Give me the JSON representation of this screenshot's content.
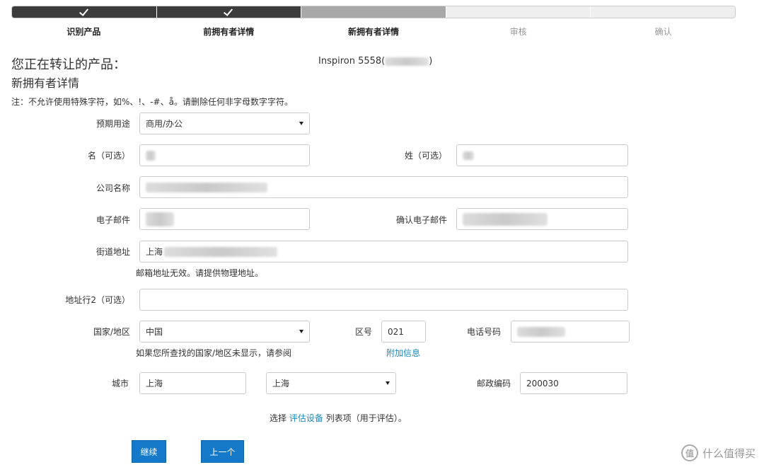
{
  "progress": {
    "steps": [
      {
        "label": "识别产品",
        "state": "done"
      },
      {
        "label": "前拥有者详情",
        "state": "done"
      },
      {
        "label": "新拥有者详情",
        "state": "current"
      },
      {
        "label": "审核",
        "state": "todo"
      },
      {
        "label": "确认",
        "state": "todo"
      }
    ]
  },
  "header": {
    "title": "您正在转让的产品：",
    "product": "Inspiron 5558(",
    "product_close": ")",
    "subtitle": "新拥有者详情",
    "note": "注：不允许使用特殊字符，如%、!、-#、å。请删除任何非字母数字字符。"
  },
  "form": {
    "usage": {
      "label": "预期用途",
      "value": "商用/办公"
    },
    "first_name": {
      "label": "名（可选）",
      "value": ""
    },
    "last_name": {
      "label": "姓（可选）",
      "value": ""
    },
    "company": {
      "label": "公司名称",
      "value": ""
    },
    "email": {
      "label": "电子邮件",
      "value": ""
    },
    "confirm_email": {
      "label": "确认电子邮件",
      "value": ""
    },
    "street": {
      "label": "街道地址",
      "value": "上海",
      "help": "邮箱地址无效。请提供物理地址。"
    },
    "address2": {
      "label": "地址行2（可选）",
      "value": ""
    },
    "country": {
      "label": "国家/地区",
      "value": "中国",
      "help": "如果您所查找的国家/地区未显示，请参阅"
    },
    "area_code": {
      "label": "区号",
      "value": "021",
      "help_link": "附加信息"
    },
    "phone": {
      "label": "电话号码",
      "value": ""
    },
    "city": {
      "label": "城市",
      "value": "上海"
    },
    "province": {
      "value": "上海"
    },
    "postal": {
      "label": "邮政编码",
      "value": "200030"
    },
    "eval_prefix": "选择",
    "eval_link": "评估设备",
    "eval_suffix": "列表项（用于评估）。"
  },
  "buttons": {
    "continue": "继续",
    "back": "上一个"
  },
  "watermark": {
    "logo": "值",
    "text": "什么值得买"
  }
}
